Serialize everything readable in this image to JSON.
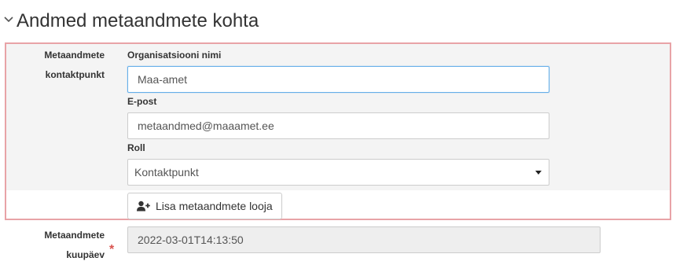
{
  "section": {
    "title": "Andmed metaandmete kohta",
    "toggle_icon": "chevron-down-icon"
  },
  "contact": {
    "side_label_line1": "Metaandmete",
    "side_label_line2": "kontaktpunkt",
    "organization": {
      "label": "Organisatsiooni nimi",
      "value": "Maa-amet"
    },
    "email": {
      "label": "E-post",
      "value": "metaandmed@maaamet.ee"
    },
    "role": {
      "label": "Roll",
      "value": "Kontaktpunkt"
    },
    "add_button": {
      "label": "Lisa metaandmete looja",
      "icon": "user-plus-icon"
    }
  },
  "metadata_date": {
    "label_line1": "Metaandmete",
    "label_line2": "kuupäev",
    "required_marker": "*",
    "value": "2022-03-01T14:13:50"
  },
  "colors": {
    "highlight_border": "#e8a3a7",
    "focus_border": "#66afe9",
    "required": "#d9534f",
    "panel_bg": "#f4f4f4",
    "readonly_bg": "#eeeeee"
  }
}
